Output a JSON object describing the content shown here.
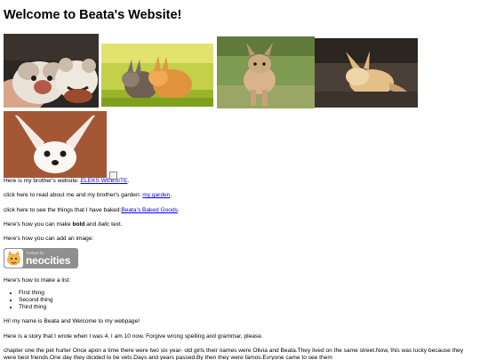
{
  "page": {
    "title": "Welcome to Beata's Website!"
  },
  "links": {
    "brother_prefix": "Here is my brother's website: ",
    "brother_link": "ELEKS WEBSITE",
    "brother_suffix": ".",
    "garden_prefix": "click here to read about me and my brother's garden: ",
    "garden_link": "my garden",
    "garden_suffix": ".",
    "baked_prefix": "click here to see the things that I have baked:",
    "baked_link": "Beata's Baked Goods",
    "baked_suffix": "."
  },
  "formatting": {
    "prefix": "Here's how you can make ",
    "bold": "bold",
    "middle": " and ",
    "italic": "italic",
    "suffix": " text."
  },
  "image_text": "Here's how you can add an image:",
  "badge": {
    "small": "hosted by",
    "big": "neocities"
  },
  "list": {
    "intro": "Here's how to make a list:",
    "items": [
      "First thing",
      "Second thing",
      "Third thing"
    ]
  },
  "intro_text": "Hi! my name is Beata and Welcome to my webpage!",
  "story_intro": "Here is a story that I wrote when I was 4. I am 10 now. Forgive wrong spelling and grammar, please.",
  "story_text": "chapter one the pet hurter Once apon a time there were two six year- old girls their names were Olivia and Beata.They lived on the same street.Now, this was lucky because they were best friends.One day they dicided to be vets.Days and years passed.By then they were famos.Evryone came to see them"
}
